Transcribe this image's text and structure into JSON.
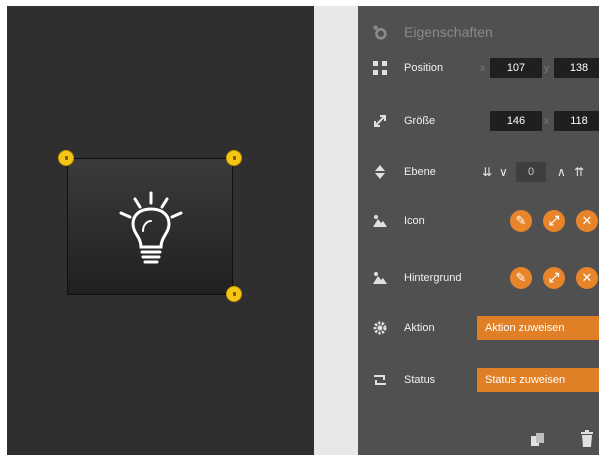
{
  "panel": {
    "title": "Eigenschaften",
    "position": {
      "label": "Position",
      "x_label": "x",
      "x": "107",
      "y_label": "y",
      "y": "138"
    },
    "size": {
      "label": "Größe",
      "w": "146",
      "sep": "x",
      "h": "118"
    },
    "layer": {
      "label": "Ebene",
      "value": "0"
    },
    "icon": {
      "label": "Icon"
    },
    "background": {
      "label": "Hintergrund"
    },
    "action": {
      "label": "Aktion",
      "button": "Aktion zuweisen"
    },
    "status": {
      "label": "Status",
      "button": "Status zuweisen"
    }
  },
  "colors": {
    "canvas": "#2f2f2f",
    "panel": "#505050",
    "accent": "#e8852a",
    "handle": "#f5c518"
  },
  "icons": {
    "widget": "lightbulb-icon",
    "actions": [
      "edit-icon",
      "resize-icon",
      "remove-icon"
    ],
    "bottom": [
      "copy-icon",
      "trash-icon"
    ]
  }
}
